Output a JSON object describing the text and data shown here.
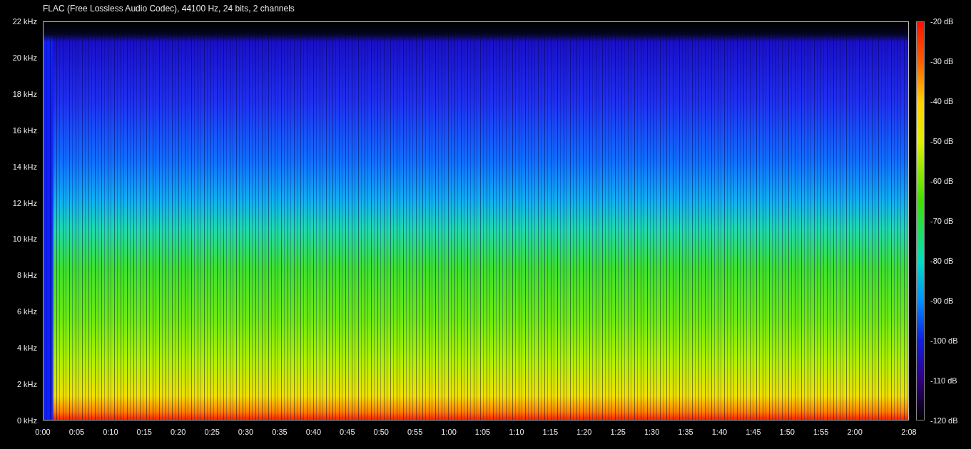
{
  "title": "FLAC (Free Lossless Audio Codec), 44100 Hz, 24 bits, 2 channels",
  "frequency_axis": [
    "22 kHz",
    "20 kHz",
    "18 kHz",
    "16 kHz",
    "14 kHz",
    "12 kHz",
    "10 kHz",
    "8 kHz",
    "6 kHz",
    "4 kHz",
    "2 kHz",
    "0 kHz"
  ],
  "time_axis": [
    "0:00",
    "0:05",
    "0:10",
    "0:15",
    "0:20",
    "0:25",
    "0:30",
    "0:35",
    "0:40",
    "0:45",
    "0:50",
    "0:55",
    "1:00",
    "1:05",
    "1:10",
    "1:15",
    "1:20",
    "1:25",
    "1:30",
    "1:35",
    "1:40",
    "1:45",
    "1:50",
    "1:55",
    "2:00",
    "2:08"
  ],
  "color_scale": [
    "-20 dB",
    "-30 dB",
    "-40 dB",
    "-50 dB",
    "-60 dB",
    "-70 dB",
    "-80 dB",
    "-90 dB",
    "-100 dB",
    "-110 dB",
    "-120 dB"
  ]
}
